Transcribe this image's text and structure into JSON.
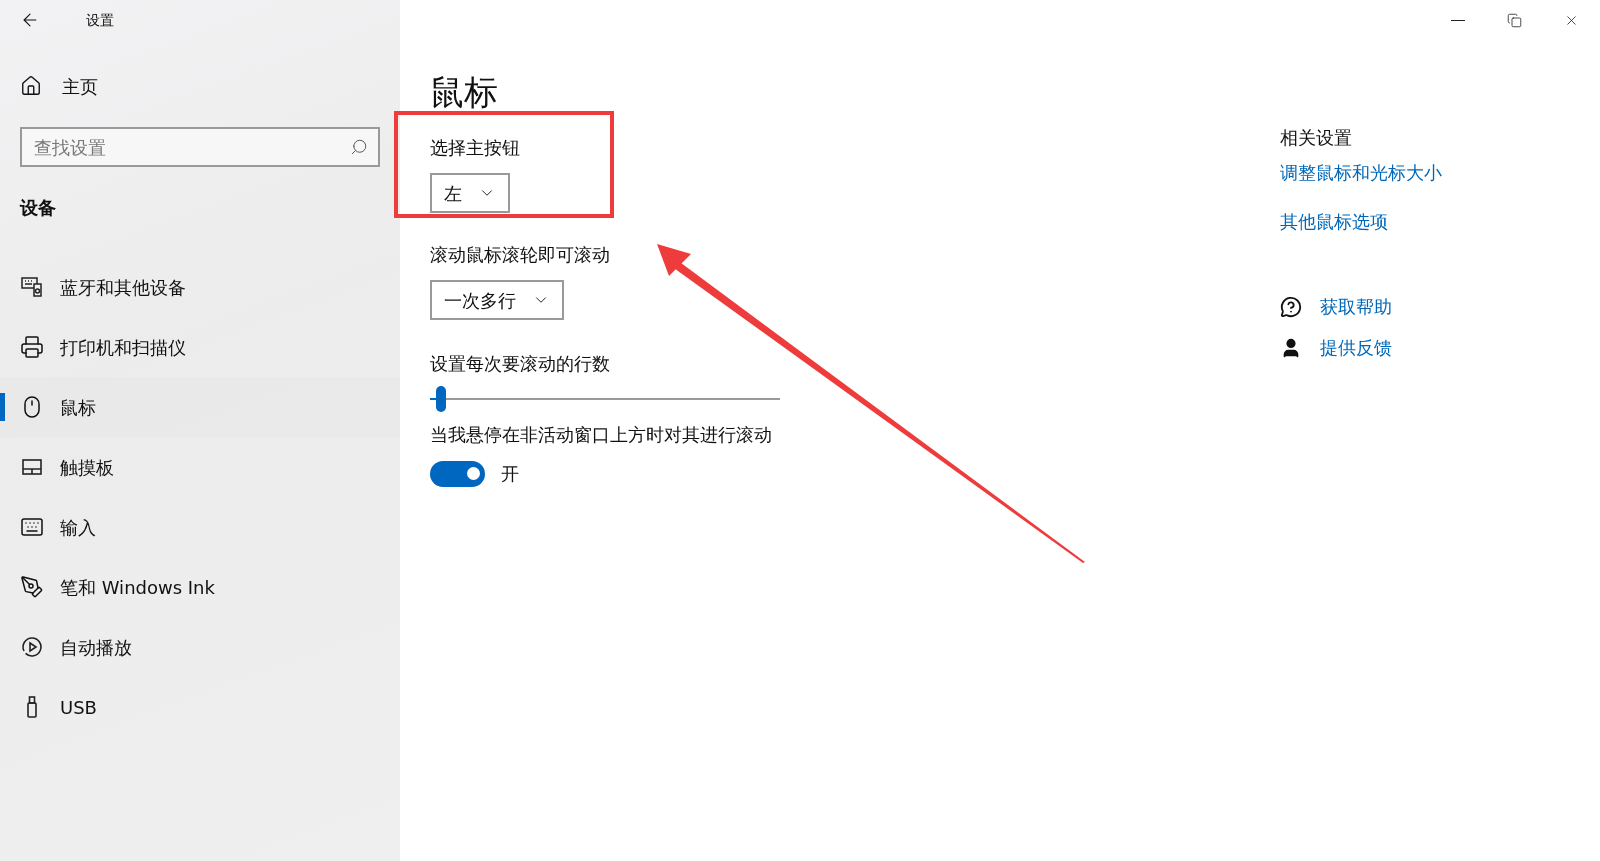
{
  "window": {
    "title": "设置"
  },
  "sidebar": {
    "home": "主页",
    "search": {
      "placeholder": "查找设置"
    },
    "section": "设备",
    "items": [
      {
        "kind": "devices",
        "label": "蓝牙和其他设备",
        "selected": false
      },
      {
        "kind": "printer",
        "label": "打印机和扫描仪",
        "selected": false
      },
      {
        "kind": "mouse",
        "label": "鼠标",
        "selected": true
      },
      {
        "kind": "touchpad",
        "label": "触摸板",
        "selected": false
      },
      {
        "kind": "keyboard",
        "label": "输入",
        "selected": false
      },
      {
        "kind": "pen",
        "label": "笔和 Windows Ink",
        "selected": false
      },
      {
        "kind": "autoplay",
        "label": "自动播放",
        "selected": false
      },
      {
        "kind": "usb",
        "label": "USB",
        "selected": false
      }
    ]
  },
  "main": {
    "title": "鼠标",
    "primary_button": {
      "label": "选择主按钮",
      "value": "左"
    },
    "wheel_scroll": {
      "label": "滚动鼠标滚轮即可滚动",
      "value": "一次多行"
    },
    "lines": {
      "label": "设置每次要滚动的行数",
      "level": 0.03
    },
    "inactive_scroll": {
      "label": "当我悬停在非活动窗口上方时对其进行滚动",
      "on": true,
      "state": "开"
    }
  },
  "related": {
    "heading": "相关设置",
    "links": [
      "调整鼠标和光标大小",
      "其他鼠标选项"
    ],
    "help": [
      {
        "kind": "help",
        "label": "获取帮助"
      },
      {
        "kind": "feedback",
        "label": "提供反馈"
      }
    ]
  }
}
